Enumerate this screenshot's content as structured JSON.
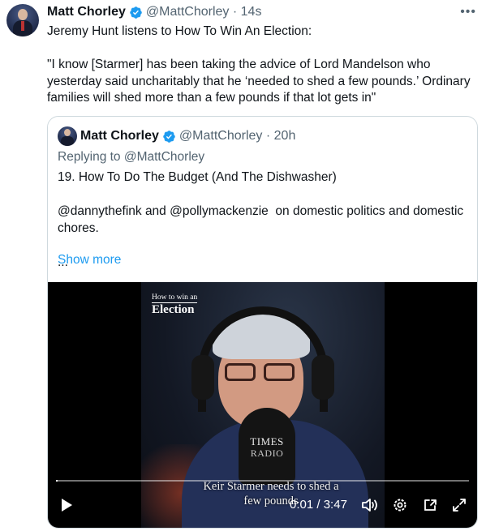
{
  "tweet": {
    "author_name": "Matt Chorley",
    "handle": "@MattChorley",
    "separator": "·",
    "time": "14s",
    "text": "Jeremy Hunt listens to How To Win An Election:\n\n\"I know [Starmer] has been taking the advice of Lord Mandelson who yesterday said uncharitably that he ‘needed to shed a few pounds.’ Ordinary families will shed more than a few pounds if that lot gets in\"",
    "more_icon": "more-dots-icon",
    "verified_icon": "verified-badge-icon"
  },
  "quoted": {
    "author_name": "Matt Chorley",
    "handle": "@MattChorley",
    "separator": "·",
    "time": "20h",
    "replying_to": "Replying to @MattChorley",
    "text": "19. How To Do The Budget (And The Dishwasher)\n\n@dannythefink and @pollymackenzie  on domestic politics and domestic chores.\n\n...",
    "show_more": "Show more"
  },
  "video": {
    "logo_small": "How to win an",
    "logo_large": "Election",
    "mic_label_line1": "TIMES",
    "mic_label_line2": "RADIO",
    "caption": "Keir Starmer needs to shed a few pounds",
    "current_time": "0:01",
    "duration": "3:47",
    "time_separator": " / ",
    "progress_fraction": 0.004,
    "controls": [
      "play-icon",
      "volume-icon",
      "settings-icon",
      "pip-icon",
      "fullscreen-icon"
    ]
  },
  "colors": {
    "accent": "#1d9bf0",
    "text": "#0f1419",
    "muted": "#536471",
    "border": "#cfd9de"
  }
}
